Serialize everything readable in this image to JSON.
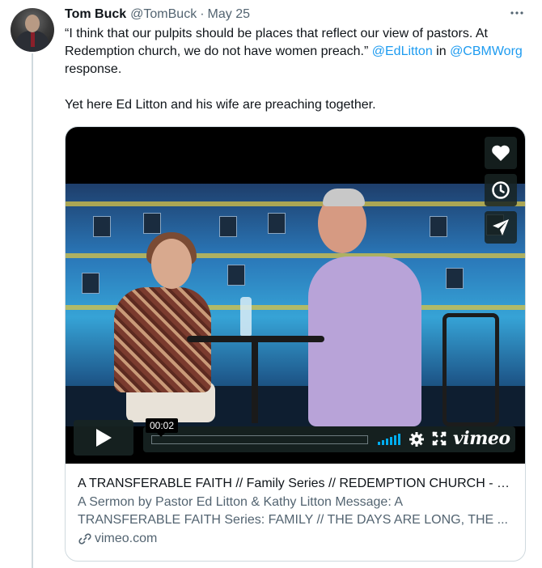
{
  "tweet": {
    "author_name": "Tom Buck",
    "author_handle": "@TomBuck",
    "separator": "·",
    "date": "May 25",
    "text_part1": "“I think that our pulpits should be places that reflect our view of pastors. At Redemption church, we do not have women preach.” ",
    "mention1": "@EdLitton",
    "text_part2": " in ",
    "mention2": "@CBMWorg",
    "text_part3": " response.",
    "text_paragraph2": "Yet here Ed Litton and his wife are preaching together."
  },
  "player": {
    "current_time": "00:02",
    "progress": 0.0,
    "brand": "vimeo",
    "side_buttons": [
      "heart-icon",
      "clock-icon",
      "send-icon"
    ],
    "accent_color": "#00adef"
  },
  "card": {
    "title": "A TRANSFERABLE FAITH // Family Series // REDEMPTION CHURCH - P...",
    "description_line1": "A Sermon by Pastor Ed Litton & Kathy Litton Message: A",
    "description_line2": "TRANSFERABLE FAITH Series: FAMILY // THE DAYS ARE LONG, THE ...",
    "domain": "vimeo.com"
  },
  "colors": {
    "link": "#1d9bf0",
    "secondary_text": "#536471",
    "border": "#cfd9de"
  }
}
